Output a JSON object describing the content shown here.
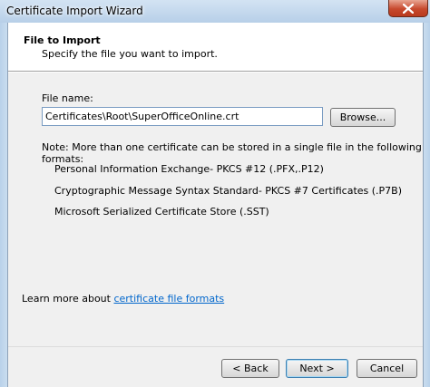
{
  "window": {
    "title": "Certificate Import Wizard"
  },
  "header": {
    "title": "File to Import",
    "subtitle": "Specify the file you want to import."
  },
  "file": {
    "label": "File name:",
    "value": "Certificates\\Root\\SuperOfficeOnline.crt",
    "browse_label": "Browse..."
  },
  "note": {
    "text": "Note:  More than one certificate can be stored in a single file in the following formats:",
    "formats": [
      "Personal Information Exchange- PKCS #12 (.PFX,.P12)",
      "Cryptographic Message Syntax Standard- PKCS #7 Certificates (.P7B)",
      "Microsoft Serialized Certificate Store (.SST)"
    ]
  },
  "learn_more": {
    "prefix": "Learn more about ",
    "link": "certificate file formats"
  },
  "buttons": {
    "back": "< Back",
    "next": "Next >",
    "cancel": "Cancel"
  },
  "colors": {
    "link": "#0066cc",
    "close_button": "#c7492d",
    "titlebar": "#c9ddef"
  }
}
